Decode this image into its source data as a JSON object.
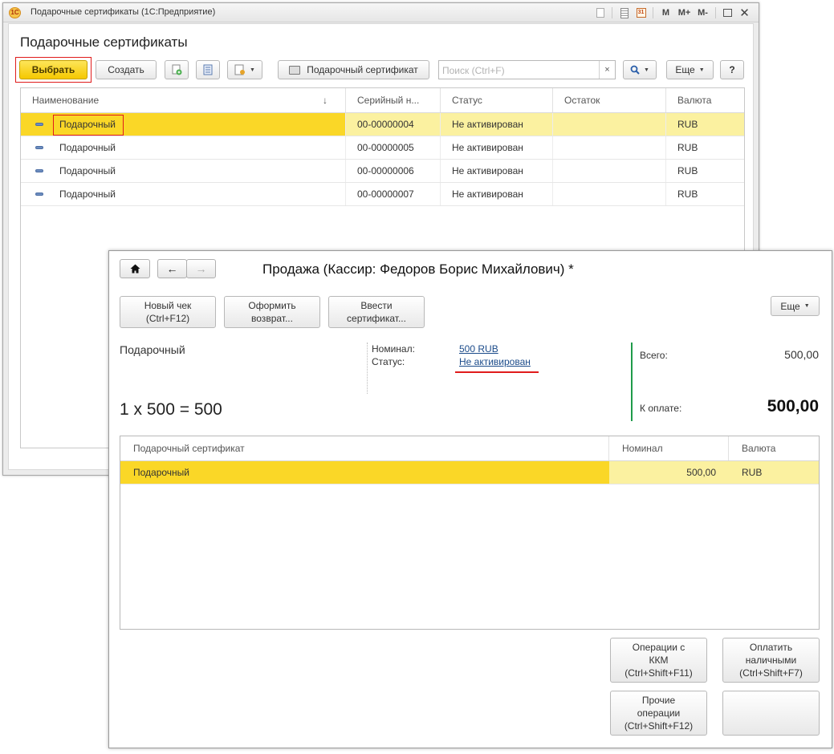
{
  "back_window": {
    "title": "Подарочные сертификаты  (1С:Предприятие)",
    "titlebar_icons": [
      "doc-icon",
      "calculator-icon",
      "calendar-icon",
      "M",
      "M+",
      "M-",
      "maximize-icon",
      "close-icon"
    ],
    "memory": {
      "m": "M",
      "m_plus": "M+",
      "m_minus": "M-"
    },
    "calendar_day": "31",
    "heading": "Подарочные сертификаты",
    "toolbar": {
      "select_label": "Выбрать",
      "create_label": "Создать",
      "print_label": "Подарочный сертификат",
      "search_placeholder": "Поиск (Ctrl+F)",
      "clear_label": "×",
      "more_label": "Еще",
      "help_label": "?"
    },
    "table": {
      "columns": [
        "Наименование",
        "Серийный н...",
        "Статус",
        "Остаток",
        "Валюта"
      ],
      "sort_indicator": "↓",
      "rows": [
        {
          "name": "Подарочный",
          "serial": "00-00000004",
          "status": "Не активирован",
          "balance": "",
          "currency": "RUB"
        },
        {
          "name": "Подарочный",
          "serial": "00-00000005",
          "status": "Не активирован",
          "balance": "",
          "currency": "RUB"
        },
        {
          "name": "Подарочный",
          "serial": "00-00000006",
          "status": "Не активирован",
          "balance": "",
          "currency": "RUB"
        },
        {
          "name": "Подарочный",
          "serial": "00-00000007",
          "status": "Не активирован",
          "balance": "",
          "currency": "RUB"
        }
      ]
    }
  },
  "front_window": {
    "title": "Продажа (Кассир: Федоров Борис Михайлович) *",
    "nav": {
      "home": "home-icon",
      "back": "←",
      "forward": "→"
    },
    "buttons": {
      "new_check_l1": "Новый чек",
      "new_check_l2": "(Ctrl+F12)",
      "return_l1": "Оформить",
      "return_l2": "возврат...",
      "enter_cert_l1": "Ввести",
      "enter_cert_l2": "сертификат...",
      "more": "Еще"
    },
    "item_name": "Подарочный",
    "formula": "1 x 500 = 500",
    "nominal_label": "Номинал:",
    "nominal_value": "500 RUB",
    "status_label": "Статус:",
    "status_value": "Не активирован",
    "total_label": "Всего:",
    "total_value": "500,00",
    "to_pay_label": "К оплате:",
    "to_pay_value": "500,00",
    "table": {
      "columns": [
        "Подарочный сертификат",
        "Номинал",
        "Валюта"
      ],
      "rows": [
        {
          "name": "Подарочный",
          "nominal": "500,00",
          "currency": "RUB"
        }
      ]
    },
    "actions": {
      "kkm_l1": "Операции с",
      "kkm_l2": "ККМ",
      "kkm_l3": "(Ctrl+Shift+F11)",
      "cash_l1": "Оплатить",
      "cash_l2": "наличными",
      "cash_l3": "(Ctrl+Shift+F7)",
      "other_l1": "Прочие",
      "other_l2": "операции",
      "other_l3": "(Ctrl+Shift+F12)"
    }
  },
  "colors": {
    "accent_yellow": "#f5c800",
    "row_highlight": "#fbf1a0",
    "row_selected_cell": "#fad727",
    "link_blue": "#1b4b8a",
    "separator_green": "#1f9b4a",
    "highlight_red": "#e01b1b"
  }
}
